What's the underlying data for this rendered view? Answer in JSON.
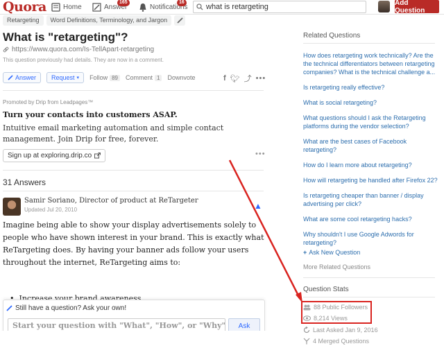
{
  "nav": {
    "logo": "Quora",
    "home": "Home",
    "answer": "Answer",
    "answer_badge": "165",
    "notifications": "Notifications",
    "notifications_badge": "16",
    "search_value": "what is retargeting",
    "add_question": "Add Question"
  },
  "question": {
    "topics": [
      "Retargeting",
      "Word Definitions, Terminology, and Jargon"
    ],
    "title": "What is \"retargeting\"?",
    "link": "https://www.quora.com/Is-TellApart-retargeting",
    "note": "This question previously had details. They are now in a comment.",
    "answer_btn": "Answer",
    "request_btn": "Request",
    "follow_label": "Follow",
    "follow_count": "89",
    "comment_label": "Comment",
    "comment_count": "1",
    "downvote_label": "Downvote"
  },
  "promo": {
    "label": "Promoted by Drip from Leadpages™",
    "title": "Turn your contacts into customers ASAP.",
    "body": "Intuitive email marketing automation and simple contact management. Join Drip for free, forever.",
    "button": "Sign up at exploring.drip.co"
  },
  "answers": {
    "count_label": "31 Answers",
    "author": "Samir Soriano, Director of product at ReTargeter",
    "date": "Updated Jul 20, 2010",
    "text": "Imagine being able to show your display advertisements solely to people who have shown interest in your brand.  This is exactly what ReTargeting does.  By having your banner ads follow your users throughout the internet, ReTargeting aims to:",
    "bullet": "Increase your brand awareness"
  },
  "still": {
    "prompt": "Still have a question? Ask your own!",
    "placeholder": "Start your question with \"What\", \"How\", or \"Why\"",
    "ask": "Ask"
  },
  "sidebar": {
    "related_heading": "Related Questions",
    "related": [
      "How does retargeting work technically? Are the the technical differentiators between retargeting companies? What is the technical challenge a...",
      "Is retargeting really effective?",
      "What is social retargeting?",
      "What questions should I ask the Retargeting platforms during the vendor selection?",
      "What are the best cases of Facebook retargeting?",
      "How do I learn more about retargeting?",
      "How will retargeting be handled after Firefox 22?",
      "Is retargeting cheaper than banner / display advertising per click?",
      "What are some cool retargeting hacks?",
      "Why shouldn't I use Google Adwords for retargeting?"
    ],
    "ask_new": "Ask New Question",
    "more_related": "More Related Questions",
    "stats_heading": "Question Stats",
    "followers": "88 Public Followers",
    "views": "8,214 Views",
    "last_asked": "Last Asked Jan 9, 2016",
    "merged": "4 Merged Questions"
  },
  "colors": {
    "brand": "#b92b27",
    "link": "#2b6dad",
    "annotation": "#d9231f"
  }
}
